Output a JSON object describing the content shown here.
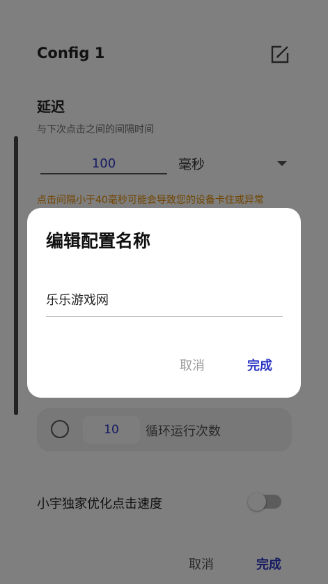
{
  "page": {
    "title": "Config 1",
    "icons": {
      "edit": "edit-icon",
      "dropdown": "chevron-down-icon"
    }
  },
  "delay": {
    "title": "延迟",
    "subtitle": "与下次点击之间的间隔时间",
    "value": "100",
    "unit": "毫秒",
    "warning": "点击间隔小于40毫秒可能会导致您的设备卡住或异常"
  },
  "loop": {
    "count": "10",
    "label": "循环运行次数"
  },
  "optimize": {
    "label": "小宇独家优化点击速度"
  },
  "footer": {
    "cancel_label": "取消",
    "done_label": "完成"
  },
  "dialog": {
    "title": "编辑配置名称",
    "input_value": "乐乐游戏网",
    "cancel_label": "取消",
    "done_label": "完成"
  },
  "colors": {
    "accent": "#2a35c4",
    "warning": "#e38a00",
    "scrim": "#000000"
  }
}
